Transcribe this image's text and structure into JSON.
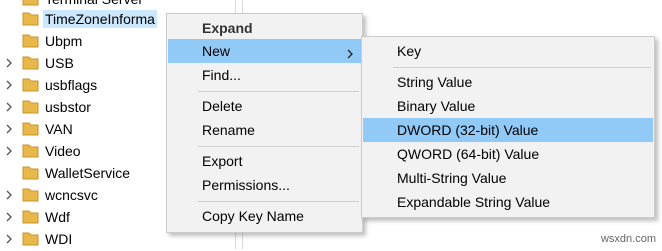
{
  "tree": {
    "partial_top_label": "Terminal Server",
    "items": [
      {
        "label": "TimeZoneInforma",
        "selected": true,
        "expandable": false
      },
      {
        "label": "Ubpm",
        "selected": false,
        "expandable": false
      },
      {
        "label": "USB",
        "selected": false,
        "expandable": true
      },
      {
        "label": "usbflags",
        "selected": false,
        "expandable": true
      },
      {
        "label": "usbstor",
        "selected": false,
        "expandable": true
      },
      {
        "label": "VAN",
        "selected": false,
        "expandable": true
      },
      {
        "label": "Video",
        "selected": false,
        "expandable": true
      },
      {
        "label": "WalletService",
        "selected": false,
        "expandable": false
      },
      {
        "label": "wcncsvc",
        "selected": false,
        "expandable": true
      },
      {
        "label": "Wdf",
        "selected": false,
        "expandable": true
      },
      {
        "label": "WDI",
        "selected": false,
        "expandable": true
      }
    ]
  },
  "context_menu": {
    "expand": "Expand",
    "new": "New",
    "find": "Find...",
    "delete": "Delete",
    "rename": "Rename",
    "export": "Export",
    "permissions": "Permissions...",
    "copy_key_name": "Copy Key Name"
  },
  "new_submenu": {
    "key": "Key",
    "string_value": "String Value",
    "binary_value": "Binary Value",
    "dword_value": "DWORD (32-bit) Value",
    "qword_value": "QWORD (64-bit) Value",
    "multi_string_value": "Multi-String Value",
    "expandable_string_value": "Expandable String Value"
  },
  "watermark": "wsxdn.com",
  "colors": {
    "highlight": "#91c9f7",
    "selected_tree": "#cce8ff",
    "menu_bg": "#f2f2f2",
    "folder": "#e8b84a"
  }
}
